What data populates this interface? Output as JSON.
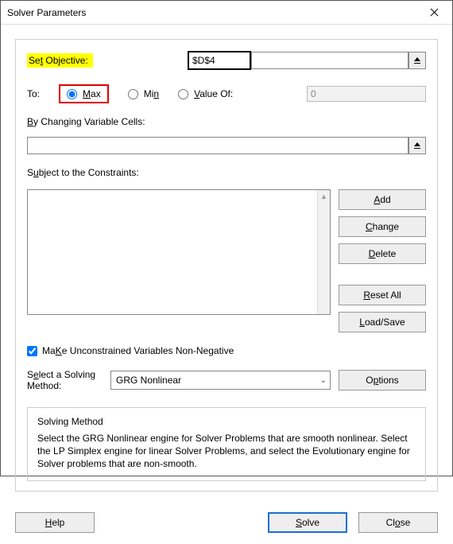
{
  "window": {
    "title": "Solver Parameters"
  },
  "labels": {
    "set_objective_pre": "Se",
    "set_objective_u": "t",
    "set_objective_post": " Objective:",
    "to": "To:",
    "max_u": "M",
    "max_post": "ax",
    "min_pre": "Mi",
    "min_u": "n",
    "valueof_u": "V",
    "valueof_post": "alue Of:",
    "by_cells_u": "B",
    "by_cells_post": "y Changing Variable Cells:",
    "subject_pre": "S",
    "subject_u": "u",
    "subject_post": "bject to the Constraints:",
    "make_unc_u": "K",
    "make_unc_pre": "Ma",
    "make_unc_post": "e Unconstrained Variables Non-Negative",
    "select_method_pre": "S",
    "select_method_u": "e",
    "select_method_post": "lect a Solving Method:",
    "solving_method_title": "Solving Method",
    "solving_method_body": "Select the GRG Nonlinear engine for Solver Problems that are smooth nonlinear. Select the LP Simplex engine for linear Solver Problems, and select the Evolutionary engine for Solver problems that are non-smooth."
  },
  "values": {
    "objective_cell": "$D$4",
    "value_of": "0",
    "changing_cells": "",
    "make_non_negative_checked": true,
    "solving_method": "GRG Nonlinear",
    "to_selected": "max"
  },
  "buttons": {
    "add_u": "A",
    "add_post": "dd",
    "change_u": "C",
    "change_post": "hange",
    "delete_u": "D",
    "delete_post": "elete",
    "reset_u": "R",
    "reset_post": "eset All",
    "load_u": "L",
    "load_post": "oad/Save",
    "options_pre": "O",
    "options_u": "p",
    "options_post": "tions",
    "help_u": "H",
    "help_post": "elp",
    "solve_u": "S",
    "solve_post": "olve",
    "close_pre": "Cl",
    "close_u": "o",
    "close_post": "se"
  }
}
